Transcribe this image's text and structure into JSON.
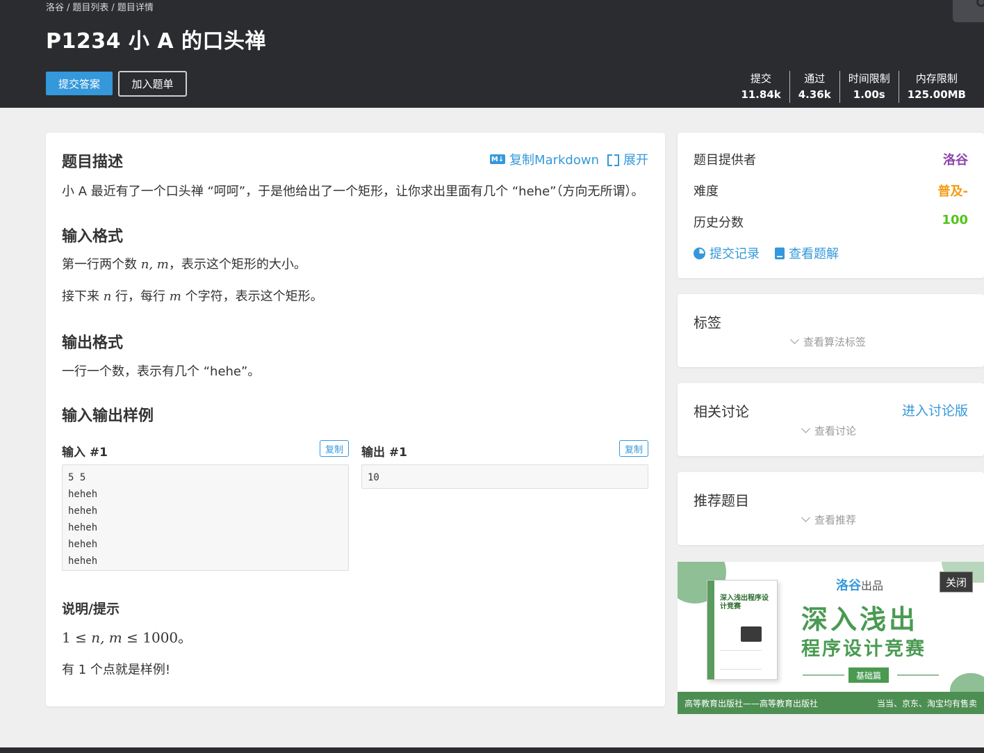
{
  "breadcrumb": [
    "洛谷",
    "题目列表",
    "题目详情"
  ],
  "problem": {
    "title": "P1234 小 A 的口头禅",
    "submit_label": "提交答案",
    "add_label": "加入题单"
  },
  "stats": [
    {
      "label": "提交",
      "value": "11.84k"
    },
    {
      "label": "通过",
      "value": "4.36k"
    },
    {
      "label": "时间限制",
      "value": "1.00s"
    },
    {
      "label": "内存限制",
      "value": "125.00MB"
    }
  ],
  "description": {
    "title": "题目描述",
    "copy_markdown": "复制Markdown",
    "md_icon_text": "M↓",
    "expand": "展开",
    "text": "小 A 最近有了一个口头禅 “呵呵”，于是他给出了一个矩形，让你求出里面有几个 “hehe”（方向无所谓）。"
  },
  "input_format": {
    "title": "输入格式",
    "line1_pre": "第一行两个数 ",
    "line1_math": "n, m",
    "line1_post": "，表示这个矩形的大小。",
    "line2_pre": "接下来 ",
    "line2_n": "n",
    "line2_mid": " 行，每行 ",
    "line2_m": "m",
    "line2_post": " 个字符，表示这个矩形。"
  },
  "output_format": {
    "title": "输出格式",
    "text": "一行一个数，表示有几个 “hehe”。"
  },
  "samples": {
    "title": "输入输出样例",
    "input_label": "输入 #1",
    "output_label": "输出 #1",
    "copy_label": "复制",
    "input_lines": [
      "5 5",
      "heheh",
      "heheh",
      "heheh",
      "heheh",
      "heheh"
    ],
    "output_lines": [
      "10"
    ]
  },
  "hint": {
    "title": "说明/提示",
    "math_pre": "1 ≤ ",
    "math_vars": "n, m",
    "math_post": " ≤ 1000",
    "math_end": "。",
    "text": "有 1 个点就是样例!"
  },
  "info": {
    "provider_label": "题目提供者",
    "provider_value": "洛谷",
    "difficulty_label": "难度",
    "difficulty_value": "普及-",
    "score_label": "历史分数",
    "score_value": "100",
    "records_link": "提交记录",
    "solutions_link": "查看题解",
    "colors": {
      "provider": "#8e44ad",
      "difficulty": "#f39c11",
      "score": "#52c41a"
    }
  },
  "tags_card": {
    "title": "标签",
    "expand": "查看算法标签"
  },
  "discuss_card": {
    "title": "相关讨论",
    "link": "进入讨论版",
    "expand": "查看讨论"
  },
  "recommend_card": {
    "title": "推荐题目",
    "expand": "查看推荐"
  },
  "ad": {
    "brand": "洛谷",
    "brand_suffix": "出品",
    "headline": "深入浅出",
    "subheadline": "程序设计竞赛",
    "tag": "基础篇",
    "book_title": "深入浅出程序设计竞赛",
    "footer_left": "高等教育出版社——高等教育出版社",
    "footer_right": "当当、京东、淘宝均有售卖",
    "close_label": "关闭"
  },
  "accent_color": "#3498db"
}
